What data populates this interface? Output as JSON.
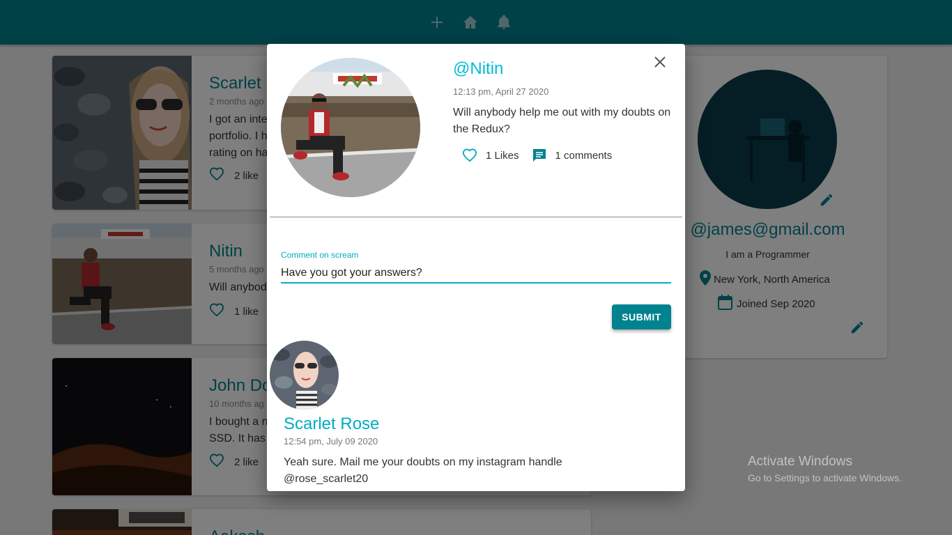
{
  "navbar": {
    "add_icon": "add-icon",
    "home_icon": "home-icon",
    "notifications_icon": "bell-icon"
  },
  "feed": {
    "posts": [
      {
        "name": "Scarlet R",
        "time": "2 months ago",
        "text": "I got an inte\nportfolio. I h\nrating on ha",
        "likes": "2 like"
      },
      {
        "name": "Nitin",
        "time": "5 months ago",
        "text": "Will anybod",
        "likes": "1 like"
      },
      {
        "name": "John Do",
        "time": "10 months ag",
        "text": "I bought a n\nSSD. It has c",
        "likes": "2 like"
      },
      {
        "name": "Aakash",
        "time": "",
        "text": "",
        "likes": ""
      }
    ]
  },
  "profile": {
    "handle": "@james@gmail.com",
    "bio": "I am a Programmer",
    "location": "New York, North America",
    "joined": "Joined Sep 2020"
  },
  "dialog": {
    "handle": "@Nitin",
    "time": "12:13 pm, April 27 2020",
    "body": "Will anybody help me out with my doubts on the Redux?",
    "likes": "1 Likes",
    "comments": "1 comments",
    "comment_field": {
      "label": "Comment on scream",
      "value": "Have you got your answers?"
    },
    "submit_label": "SUBMIT",
    "comment": {
      "name": "Scarlet Rose",
      "time": "12:54 pm, July 09 2020",
      "body": "Yeah sure. Mail me your doubts on my instagram handle @rose_scarlet20"
    }
  },
  "watermark": {
    "title": "Activate Windows",
    "subtitle": "Go to Settings to activate Windows."
  },
  "colors": {
    "primary": "#00838f",
    "accent": "#00bcd4"
  }
}
